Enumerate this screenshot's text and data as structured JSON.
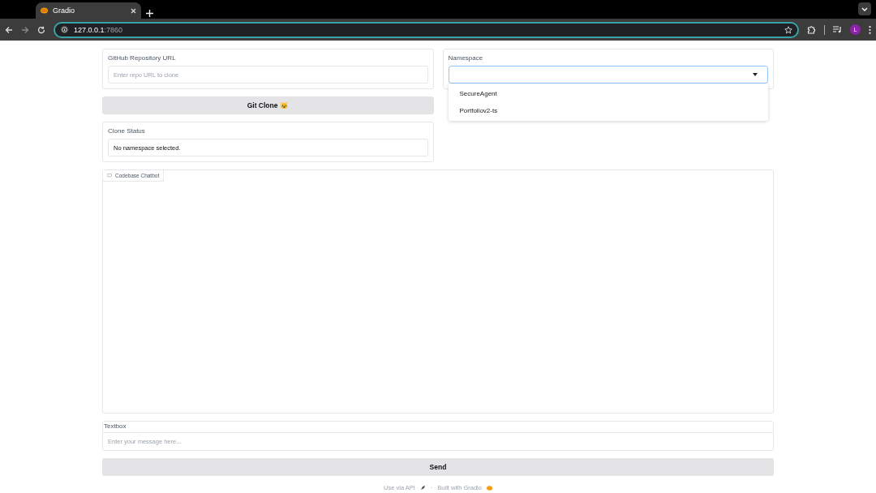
{
  "browser": {
    "tab_title": "Gradio",
    "url_host": "127.0.0.1",
    "url_port": ":7860",
    "profile_initial": "L"
  },
  "repo_url": {
    "label": "GitHub Repository URL",
    "placeholder": "Enter repo URL to clone"
  },
  "namespace": {
    "label": "Namespace",
    "expanded": true,
    "options": [
      {
        "label": "SecureAgent",
        "selected": false
      },
      {
        "label": "Portfoliov2-ts",
        "selected": false
      }
    ]
  },
  "clone_button": {
    "label": "Git Clone 😺"
  },
  "clone_status": {
    "label": "Clone Status",
    "value": "No namespace selected."
  },
  "chatbot": {
    "label": "Codebase Chatbot"
  },
  "message": {
    "label": "Textbox",
    "placeholder": "Enter your message here..."
  },
  "send_button": {
    "label": "Send"
  },
  "footer": {
    "api_link": "Use via API",
    "separator": "·",
    "built_with": "Built with Gradio"
  }
}
